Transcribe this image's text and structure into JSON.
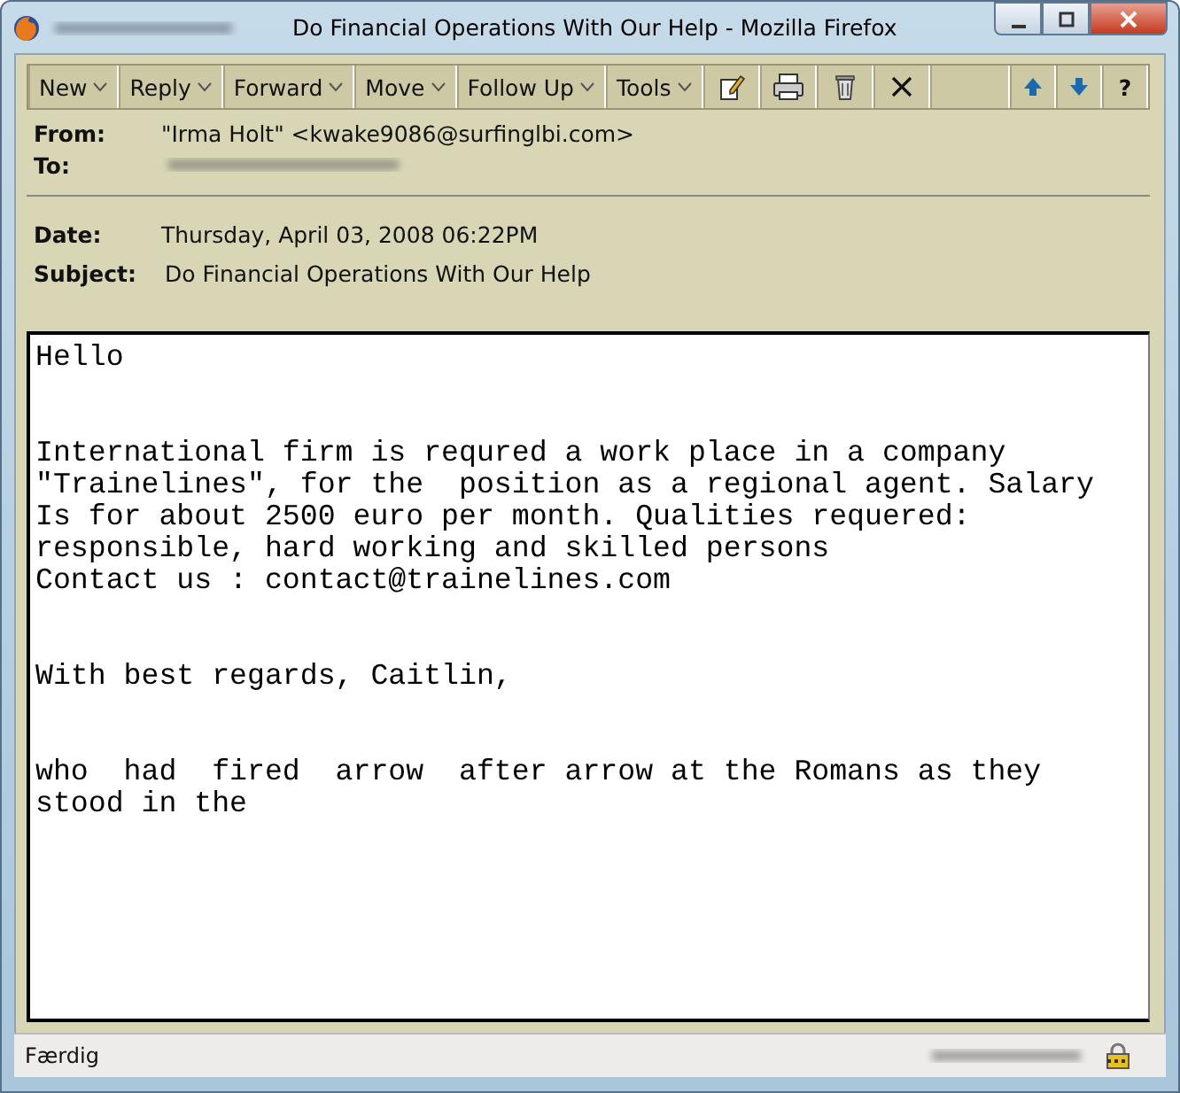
{
  "window": {
    "title": "Do Financial Operations  With Our Help - Mozilla Firefox"
  },
  "toolbar": {
    "menus": [
      {
        "label": "New"
      },
      {
        "label": "Reply"
      },
      {
        "label": "Forward"
      },
      {
        "label": "Move"
      },
      {
        "label": "Follow Up"
      },
      {
        "label": "Tools"
      }
    ],
    "help": "?"
  },
  "header": {
    "from_label": "From:",
    "from": "\"Irma Holt\" <kwake9086@surfinglbi.com>",
    "to_label": "To:",
    "date_label": "Date:",
    "date": "Thursday, April 03, 2008 06:22PM",
    "subject_label": "Subject:",
    "subject": "Do Financial Operations With Our Help"
  },
  "body": [
    "Hello",
    "International firm is requred a work place in a company\n\"Trainelines\", for the  position as a regional agent. Salary\nIs for about 2500 euro per month. Qualities requered:\nresponsible, hard working and skilled persons\nContact us : contact@trainelines.com",
    "With best regards, Caitlin,",
    "who  had  fired  arrow  after arrow at the Romans as they\nstood in the"
  ],
  "status_bar": {
    "text": "Færdig"
  }
}
